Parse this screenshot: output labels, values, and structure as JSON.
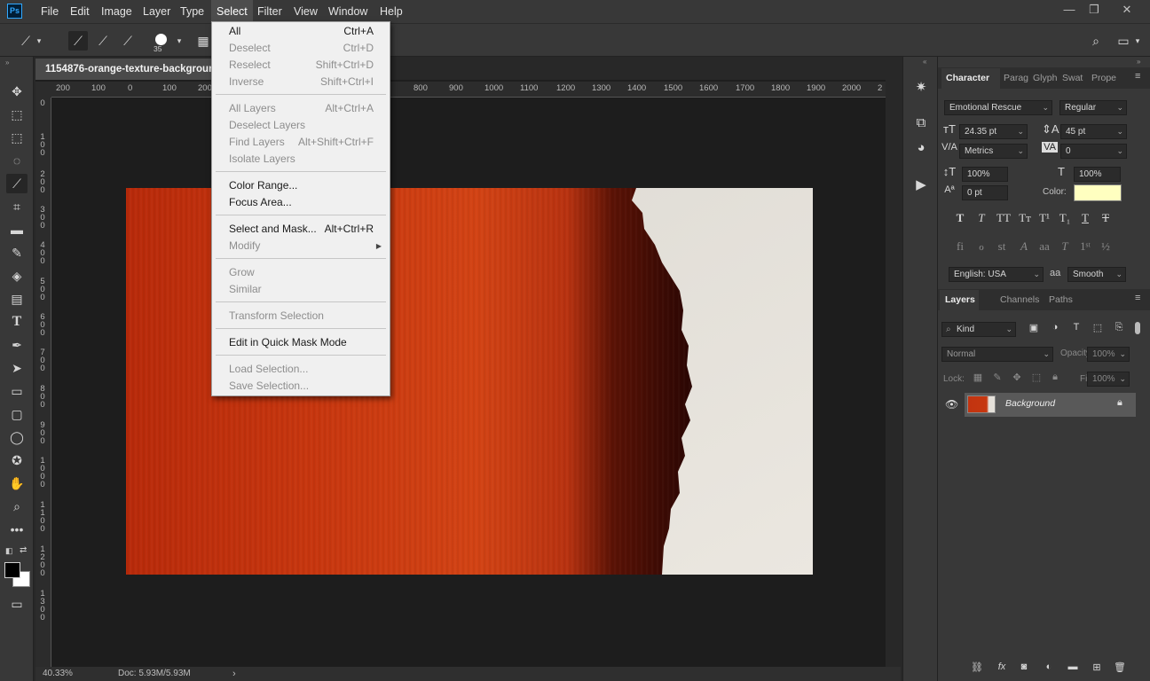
{
  "app": {
    "logo": "Ps"
  },
  "menubar": {
    "items": [
      "File",
      "Edit",
      "Image",
      "Layer",
      "Type",
      "Select",
      "Filter",
      "View",
      "Window",
      "Help"
    ],
    "active": "Select"
  },
  "window_controls": {
    "minimize": "—",
    "restore": "❐",
    "close": "✕"
  },
  "options_bar": {
    "brush_size": "35"
  },
  "document": {
    "tab_title": "1154876-orange-texture-background",
    "zoom": "40.33%",
    "doc_info": "Doc: 5.93M/5.93M",
    "ruler_h": [
      "200",
      "100",
      "0",
      "100",
      "200",
      "800",
      "900",
      "1000",
      "1100",
      "1200",
      "1300",
      "1400",
      "1500",
      "1600",
      "1700",
      "1800",
      "1900",
      "2000",
      "2"
    ],
    "ruler_v": [
      "0",
      "1 0 0",
      "2 0 0",
      "3 0 0",
      "4 0 0",
      "5 0 0",
      "6 0 0",
      "7 0 0",
      "8 0 0",
      "9 0 0",
      "1 0 0 0",
      "1 1 0 0",
      "1 2 0 0",
      "1 3 0 0"
    ]
  },
  "select_menu": {
    "items": [
      {
        "label": "All",
        "shortcut": "Ctrl+A",
        "enabled": true
      },
      {
        "label": "Deselect",
        "shortcut": "Ctrl+D",
        "enabled": false
      },
      {
        "label": "Reselect",
        "shortcut": "Shift+Ctrl+D",
        "enabled": false
      },
      {
        "label": "Inverse",
        "shortcut": "Shift+Ctrl+I",
        "enabled": false
      },
      {
        "label": "All Layers",
        "shortcut": "Alt+Ctrl+A",
        "enabled": false
      },
      {
        "label": "Deselect Layers",
        "shortcut": "",
        "enabled": false
      },
      {
        "label": "Find Layers",
        "shortcut": "Alt+Shift+Ctrl+F",
        "enabled": false
      },
      {
        "label": "Isolate Layers",
        "shortcut": "",
        "enabled": false
      },
      {
        "label": "Color Range...",
        "shortcut": "",
        "enabled": true
      },
      {
        "label": "Focus Area...",
        "shortcut": "",
        "enabled": true
      },
      {
        "label": "Select and Mask...",
        "shortcut": "Alt+Ctrl+R",
        "enabled": true
      },
      {
        "label": "Modify",
        "shortcut": "",
        "enabled": false,
        "submenu": true
      },
      {
        "label": "Grow",
        "shortcut": "",
        "enabled": false
      },
      {
        "label": "Similar",
        "shortcut": "",
        "enabled": false
      },
      {
        "label": "Transform Selection",
        "shortcut": "",
        "enabled": false
      },
      {
        "label": "Edit in Quick Mask Mode",
        "shortcut": "",
        "enabled": true
      },
      {
        "label": "Load Selection...",
        "shortcut": "",
        "enabled": false
      },
      {
        "label": "Save Selection...",
        "shortcut": "",
        "enabled": false
      }
    ]
  },
  "character_panel": {
    "tabs": [
      "Character",
      "Parag",
      "Glyph",
      "Swat",
      "Prope"
    ],
    "font_family": "Emotional Rescue",
    "font_style": "Regular",
    "font_size": "24.35 pt",
    "leading": "45 pt",
    "kerning": "Metrics",
    "tracking": "0",
    "vertical_scale": "100%",
    "horizontal_scale": "100%",
    "baseline_shift": "0 pt",
    "color_label": "Color:",
    "text_color": "#ffffc0",
    "language": "English: USA",
    "antialias_icon": "aa",
    "antialias": "Smooth"
  },
  "layers_panel": {
    "tabs": [
      "Layers",
      "Channels",
      "Paths"
    ],
    "filter_kind": "Kind",
    "blend_mode": "Normal",
    "opacity_label": "Opacity:",
    "opacity": "100%",
    "lock_label": "Lock:",
    "fill_label": "Fill:",
    "fill": "100%",
    "layers": [
      {
        "name": "Background",
        "visible": true,
        "locked": true
      }
    ]
  },
  "colors": {
    "accent": "#31a8ff",
    "orange": "#c9360d",
    "paper": "#e4e0d9"
  }
}
